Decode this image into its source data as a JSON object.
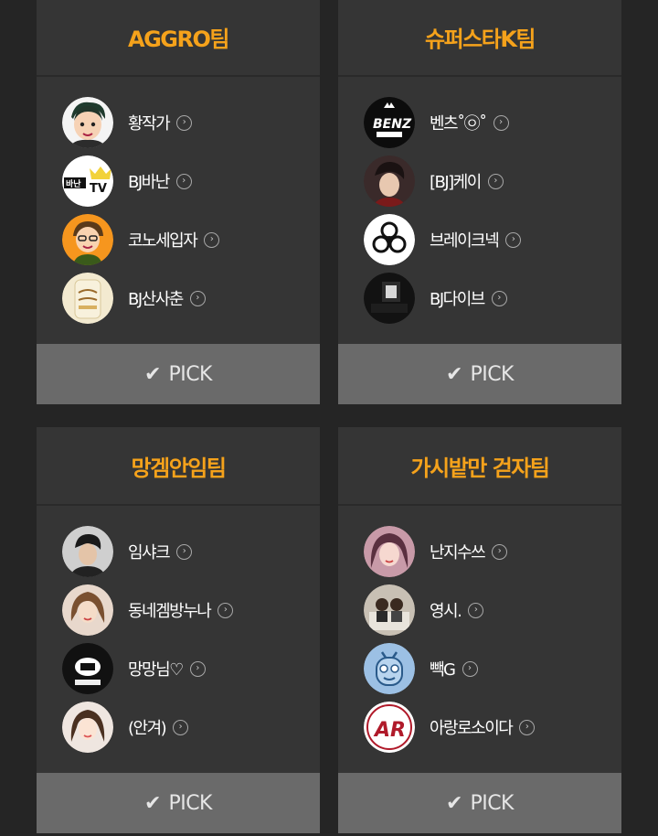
{
  "teams": [
    {
      "name": "AGGRO팀",
      "pick_label": "PICK",
      "members": [
        {
          "name": "황작가",
          "avatar": "cartoon-man-avatar"
        },
        {
          "name": "BJ바난",
          "avatar": "banan-tv-logo"
        },
        {
          "name": "코노세입자",
          "avatar": "cono-cartoon-avatar"
        },
        {
          "name": "BJ산사춘",
          "avatar": "sansachun-bottle-avatar"
        }
      ]
    },
    {
      "name": "슈퍼스타K팀",
      "pick_label": "PICK",
      "members": [
        {
          "name": "벤츠˚㉧˚",
          "avatar": "benz-logo"
        },
        {
          "name": "[BJ]케이",
          "avatar": "photo-avatar"
        },
        {
          "name": "브레이크넥",
          "avatar": "biohazard-logo"
        },
        {
          "name": "BJ다이브",
          "avatar": "dark-photo-avatar"
        }
      ]
    },
    {
      "name": "망겜안임팀",
      "pick_label": "PICK",
      "members": [
        {
          "name": "임샤크",
          "avatar": "photo-avatar"
        },
        {
          "name": "동네겜방누나",
          "avatar": "photo-avatar"
        },
        {
          "name": "망망님♡",
          "avatar": "black-white-logo"
        },
        {
          "name": "(안겨)",
          "avatar": "photo-avatar"
        }
      ]
    },
    {
      "name": "가시밭만 걷자팀",
      "pick_label": "PICK",
      "members": [
        {
          "name": "난지수쓰",
          "avatar": "photo-avatar"
        },
        {
          "name": "영시.",
          "avatar": "photo-avatar"
        },
        {
          "name": "빽G",
          "avatar": "blue-robot-avatar"
        },
        {
          "name": "아랑로소이다",
          "avatar": "ar-logo"
        }
      ]
    }
  ],
  "icons": {
    "chevron": "›",
    "check": "✔"
  },
  "colors": {
    "page_bg": "#252525",
    "card_bg": "#353535",
    "team_title": "#f5a21b",
    "pick_bg": "#6a6a6a"
  }
}
